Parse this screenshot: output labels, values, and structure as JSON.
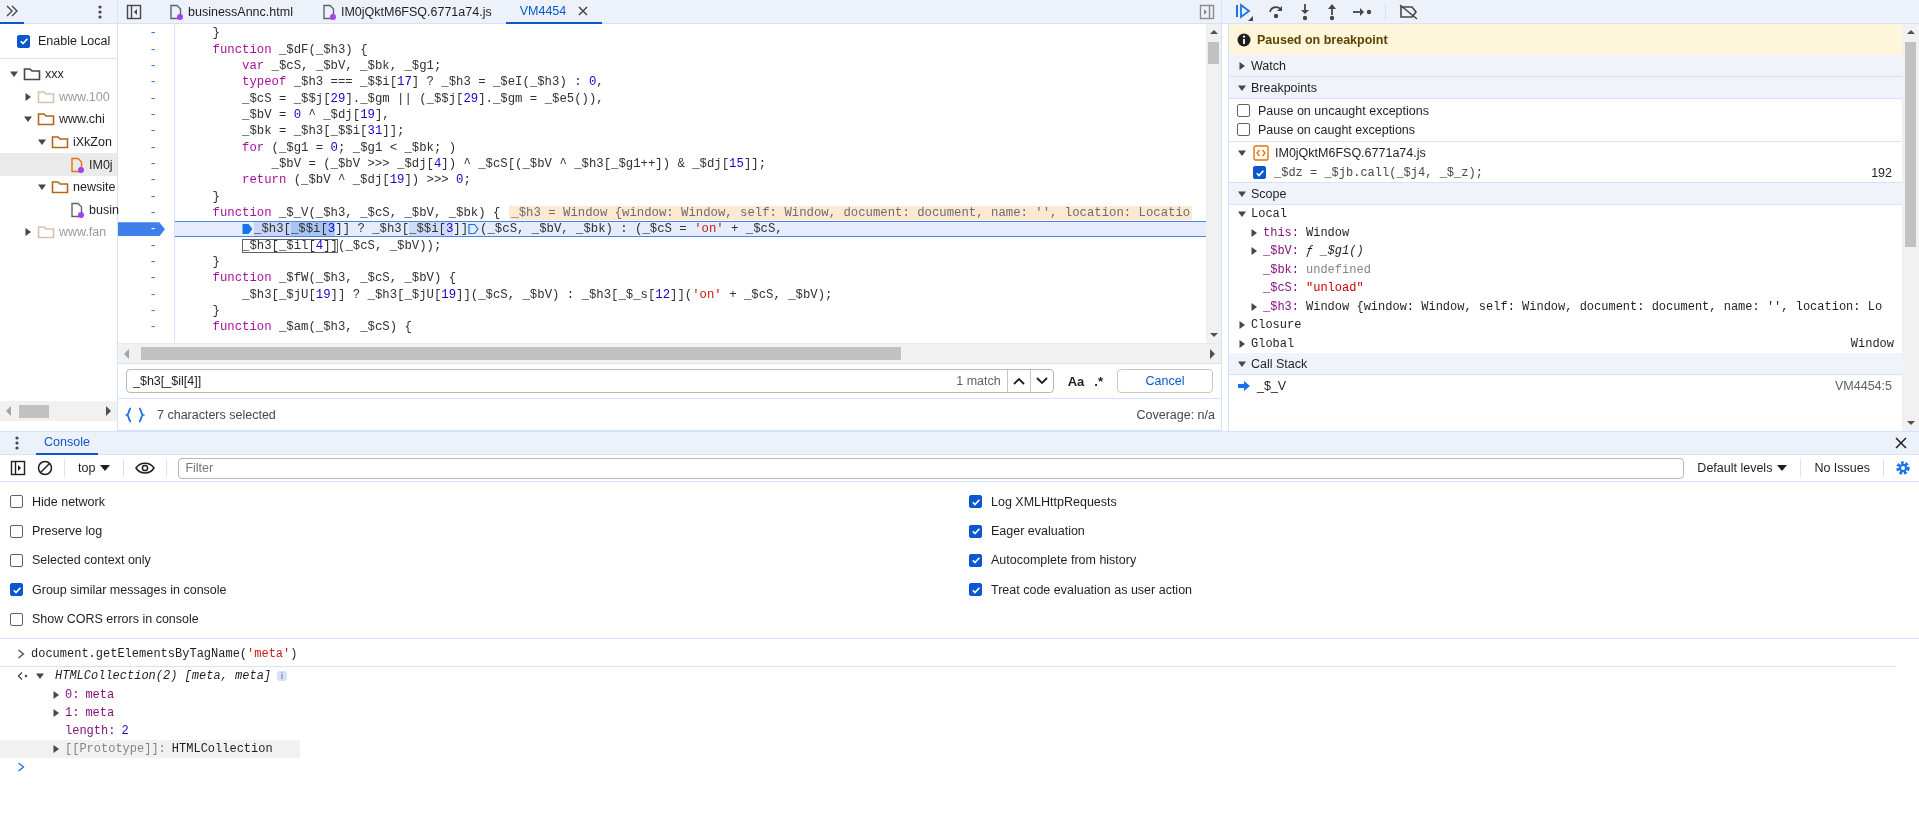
{
  "navigator": {
    "enable_local": {
      "label": "Enable Local",
      "checked": true
    },
    "tree": [
      {
        "label": "xxx",
        "kind": "root",
        "expanded": true,
        "selected": false,
        "children": [
          {
            "label": "www.100",
            "kind": "folder",
            "dimmed": true,
            "expanded": false,
            "selected": false
          },
          {
            "label": "www.chi",
            "kind": "folder",
            "dimmed": false,
            "expanded": true,
            "selected": false,
            "children": [
              {
                "label": "iXkZon",
                "kind": "folder",
                "dimmed": false,
                "expanded": true,
                "selected": false,
                "children": [
                  {
                    "label": "IM0j",
                    "kind": "script",
                    "selected": true
                  }
                ]
              },
              {
                "label": "newsite",
                "kind": "folder",
                "dimmed": false,
                "expanded": true,
                "selected": false,
                "children": [
                  {
                    "label": "busin",
                    "kind": "document",
                    "selected": false
                  }
                ]
              }
            ]
          },
          {
            "label": "www.fan",
            "kind": "folder",
            "dimmed": true,
            "expanded": false,
            "selected": false
          }
        ]
      }
    ]
  },
  "editor": {
    "tabs": [
      {
        "label": "businessAnnc.html",
        "selected": false,
        "closable": false
      },
      {
        "label": "IM0jQktM6FSQ.6771a74.js",
        "selected": false,
        "closable": false
      },
      {
        "label": "VM4454",
        "selected": true,
        "closable": true
      }
    ],
    "lines": [
      {
        "gutter": "-",
        "paused": false,
        "breakpoint": false,
        "segments": [
          {
            "text": "    }"
          }
        ]
      },
      {
        "gutter": "-",
        "paused": false,
        "breakpoint": false,
        "segments": [
          {
            "text": "    function _$dF(_$h3) {"
          }
        ]
      },
      {
        "gutter": "-",
        "paused": false,
        "breakpoint": false,
        "segments": [
          {
            "text": "        var _$cS, _$bV, _$bk, _$g1;"
          }
        ]
      },
      {
        "gutter": "-",
        "paused": false,
        "breakpoint": false,
        "segments": [
          {
            "text": "        typeof _$h3 === _$$i[17] ? _$h3 = _$eI(_$h3) : 0,"
          }
        ]
      },
      {
        "gutter": "-",
        "paused": false,
        "breakpoint": false,
        "segments": [
          {
            "text": "        _$cS = _$$j[29]._$gm || (_$$j[29]._$gm = _$e5()),"
          }
        ]
      },
      {
        "gutter": "-",
        "paused": false,
        "breakpoint": false,
        "segments": [
          {
            "text": "        _$bV = 0 ^ _$dj[19],"
          }
        ]
      },
      {
        "gutter": "-",
        "paused": false,
        "breakpoint": false,
        "segments": [
          {
            "text": "        _$bk = _$h3[_$$i[31]];"
          }
        ]
      },
      {
        "gutter": "-",
        "paused": false,
        "breakpoint": false,
        "segments": [
          {
            "text": "        for (_$g1 = 0; _$g1 < _$bk; )"
          }
        ]
      },
      {
        "gutter": "-",
        "paused": false,
        "breakpoint": false,
        "segments": [
          {
            "text": "            _$bV = (_$bV >>> _$dj[4]) ^ _$cS[(_$bV ^ _$h3[_$g1++]) & _$dj[15]];"
          }
        ]
      },
      {
        "gutter": "-",
        "paused": false,
        "breakpoint": false,
        "segments": [
          {
            "text": "        return (_$bV ^ _$dj[19]) >>> 0;"
          }
        ]
      },
      {
        "gutter": "-",
        "paused": false,
        "breakpoint": false,
        "segments": [
          {
            "text": "    }"
          }
        ]
      },
      {
        "gutter": "-",
        "paused": false,
        "breakpoint": false,
        "segments": [
          {
            "text": "    function _$_V(_$h3, _$cS, _$bV, _$bk) {"
          }
        ],
        "inline_value": "_$h3 = Window {window: Window, self: Window, document: document, name: '', location: Locatio"
      },
      {
        "gutter": "-",
        "paused": true,
        "breakpoint": true,
        "segments": [
          {
            "kind": "marker",
            "active": true
          },
          {
            "text": "        _$h3[",
            "kind": "execution"
          },
          {
            "text": "_$$i[3",
            "kind": "selection"
          },
          {
            "text": "]] ? _$h3["
          },
          {
            "text": "_$$i[3",
            "kind": "occurrence"
          },
          {
            "text": "]]"
          },
          {
            "kind": "marker",
            "active": false
          },
          {
            "text": "(_$cS, _$bV, _$bk) : (_$cS = 'on' + _$cS,"
          }
        ]
      },
      {
        "gutter": "-",
        "paused": false,
        "breakpoint": false,
        "segments": [
          {
            "text": "        _$h3[_$il[4]]",
            "kind": "match"
          },
          {
            "text": "(_$cS, _$bV));"
          }
        ]
      },
      {
        "gutter": "-",
        "paused": false,
        "breakpoint": false,
        "segments": [
          {
            "text": "    }"
          }
        ]
      },
      {
        "gutter": "-",
        "paused": false,
        "breakpoint": false,
        "segments": [
          {
            "text": "    function _$fW(_$h3, _$cS, _$bV) {"
          }
        ]
      },
      {
        "gutter": "-",
        "paused": false,
        "breakpoint": false,
        "segments": [
          {
            "text": "        _$h3[_$jU[19]] ? _$h3[_$jU[19]](_$cS, _$bV) : _$h3[_$_s[12]]('on' + _$cS, _$bV);"
          }
        ]
      },
      {
        "gutter": "-",
        "paused": false,
        "breakpoint": false,
        "segments": [
          {
            "text": "    }"
          }
        ]
      },
      {
        "gutter": "-",
        "paused": false,
        "breakpoint": false,
        "segments": [
          {
            "text": "    function _$am(_$h3, _$cS) {"
          }
        ]
      }
    ],
    "search": {
      "value": "_$h3[_$il[4]]",
      "match_count": "1 match",
      "case_toggle": "Aa",
      "regex_toggle": ".*",
      "cancel": "Cancel"
    },
    "status": {
      "selection": "7 characters selected",
      "coverage": "Coverage: n/a"
    }
  },
  "debugger": {
    "paused_message": "Paused on breakpoint",
    "sections": [
      {
        "title": "Watch",
        "expanded": false
      },
      {
        "kind": "breakpoints",
        "title": "Breakpoints",
        "expanded": true,
        "options": [
          {
            "label": "Pause on uncaught exceptions",
            "checked": false
          },
          {
            "label": "Pause on caught exceptions",
            "checked": false
          }
        ],
        "files": [
          {
            "name": "IM0jQktM6FSQ.6771a74.js",
            "expanded": true,
            "breakpoints": [
              {
                "code": "_$dz = _$jb.call(_$j4, _$_z);",
                "line": "192",
                "checked": true
              }
            ]
          }
        ]
      },
      {
        "kind": "scope",
        "title": "Scope",
        "expanded": true,
        "scopes": [
          {
            "title": "Local",
            "expanded": true,
            "variables": [
              {
                "name": "this:",
                "value": "Window",
                "kind": "object",
                "expandable": true
              },
              {
                "name": "_$bV:",
                "value": "ƒ _$g1()",
                "kind": "function",
                "expandable": true
              },
              {
                "name": "_$bk:",
                "value": "undefined",
                "kind": "undefined",
                "expandable": false
              },
              {
                "name": "_$cS:",
                "value": "\"unload\"",
                "kind": "string",
                "expandable": false
              },
              {
                "name": "_$h3:",
                "value": "Window {window: Window, self: Window, document: document, name: '', location: Lo",
                "kind": "object",
                "expandable": true
              }
            ]
          },
          {
            "title": "Closure",
            "expanded": false
          },
          {
            "title": "Global",
            "expanded": false,
            "value": "Window"
          }
        ]
      },
      {
        "kind": "call_stack",
        "title": "Call Stack",
        "expanded": true,
        "frames": [
          {
            "function": "_$_V",
            "location": "VM4454:5",
            "selected": true
          }
        ]
      }
    ]
  },
  "drawer": {
    "tabs": [
      {
        "label": "Console",
        "selected": true
      }
    ],
    "toolbar": {
      "context": "top",
      "filter_placeholder": "Filter",
      "levels": "Default levels",
      "issues": "No Issues"
    },
    "settings_left": [
      {
        "label": "Hide network",
        "checked": false
      },
      {
        "label": "Preserve log",
        "checked": false
      },
      {
        "label": "Selected context only",
        "checked": false
      },
      {
        "label": "Group similar messages in console",
        "checked": true
      },
      {
        "label": "Show CORS errors in console",
        "checked": false
      }
    ],
    "settings_right": [
      {
        "label": "Log XMLHttpRequests",
        "checked": true
      },
      {
        "label": "Eager evaluation",
        "checked": true
      },
      {
        "label": "Autocomplete from history",
        "checked": true
      },
      {
        "label": "Treat code evaluation as user action",
        "checked": true
      }
    ],
    "console": [
      {
        "kind": "input",
        "text": "document.getElementsByTagName('meta')"
      },
      {
        "kind": "result",
        "summary": "HTMLCollection(2) [meta, meta]",
        "badge": "i",
        "expanded": true,
        "properties": [
          {
            "key": "0:",
            "value": "meta",
            "kind": "element",
            "expandable": true,
            "highlighted": false
          },
          {
            "key": "1:",
            "value": "meta",
            "kind": "element",
            "expandable": true,
            "highlighted": false
          },
          {
            "key": "length:",
            "value": "2",
            "kind": "number",
            "expandable": false,
            "highlighted": false
          },
          {
            "key": "[[Prototype]]:",
            "value": "HTMLCollection",
            "kind": "internal",
            "expandable": true,
            "highlighted": true
          }
        ]
      },
      {
        "kind": "prompt"
      }
    ]
  }
}
